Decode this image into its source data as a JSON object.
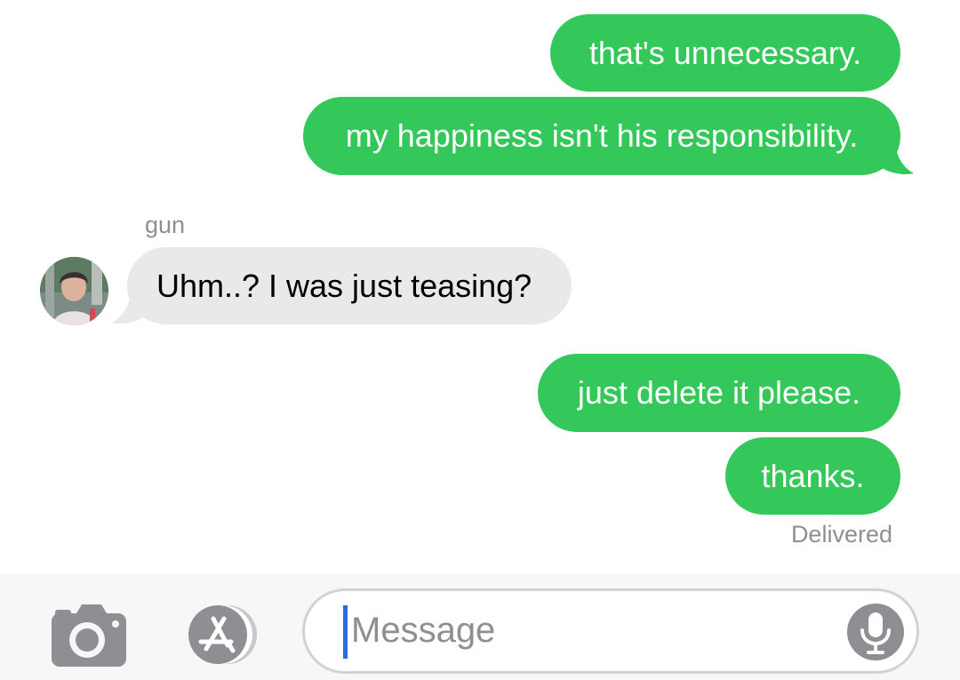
{
  "conversation": {
    "messages": [
      {
        "direction": "outgoing",
        "text": "that's unnecessary."
      },
      {
        "direction": "outgoing",
        "text": "my happiness isn't his responsibility."
      },
      {
        "direction": "incoming",
        "sender": "gun",
        "text": "Uhm..? I was just teasing?"
      },
      {
        "direction": "outgoing",
        "text": "just delete it please."
      },
      {
        "direction": "outgoing",
        "text": "thanks."
      }
    ],
    "status": "Delivered"
  },
  "composer": {
    "placeholder": "Message",
    "camera_icon": "camera-icon",
    "apps_icon": "app-store-icon",
    "mic_icon": "microphone-icon"
  },
  "colors": {
    "outgoing_bubble": "#34C759",
    "incoming_bubble": "#E9E9EB",
    "meta_text": "#8E8E93",
    "caret": "#2E6BE6"
  }
}
